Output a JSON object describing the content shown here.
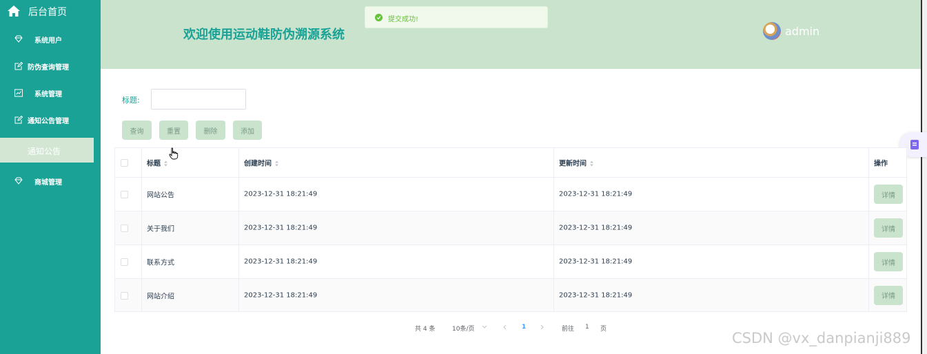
{
  "sidebar": {
    "home_label": "后台首页",
    "items": [
      {
        "label": "系统用户",
        "icon": "diamond-icon"
      },
      {
        "label": "防伪查询管理",
        "icon": "edit-icon"
      },
      {
        "label": "系统管理",
        "icon": "chart-icon"
      },
      {
        "label": "通知公告管理",
        "icon": "edit-icon"
      },
      {
        "label": "通知公告",
        "icon": ""
      },
      {
        "label": "商城管理",
        "icon": "diamond-icon"
      }
    ]
  },
  "header": {
    "title": "欢迎使用运动鞋防伪溯源系统",
    "username": "admin"
  },
  "toast": {
    "message": "提交成功!"
  },
  "search": {
    "label": "标题:",
    "value": ""
  },
  "buttons": {
    "query": "查询",
    "reset": "重置",
    "delete": "删除",
    "add": "添加"
  },
  "table": {
    "columns": [
      "标题",
      "创建时间",
      "更新时间",
      "操作"
    ],
    "rows": [
      {
        "title": "网站公告",
        "created": "2023-12-31 18:21:49",
        "updated": "2023-12-31 18:21:49",
        "action": "详情"
      },
      {
        "title": "关于我们",
        "created": "2023-12-31 18:21:49",
        "updated": "2023-12-31 18:21:49",
        "action": "详情"
      },
      {
        "title": "联系方式",
        "created": "2023-12-31 18:21:49",
        "updated": "2023-12-31 18:21:49",
        "action": "详情"
      },
      {
        "title": "网站介绍",
        "created": "2023-12-31 18:21:49",
        "updated": "2023-12-31 18:21:49",
        "action": "详情"
      }
    ]
  },
  "pagination": {
    "total": "共 4 条",
    "page_size": "10条/页",
    "current_page": "1",
    "goto_prefix": "前往",
    "goto_value": "1",
    "goto_suffix": "页"
  },
  "watermark": "CSDN @vx_danpianji889",
  "colors": {
    "sidebar": "#1aa296",
    "header": "#c9e3cd",
    "button": "#c9e3cd",
    "success": "#67c23a",
    "page_active": "#409eff"
  }
}
